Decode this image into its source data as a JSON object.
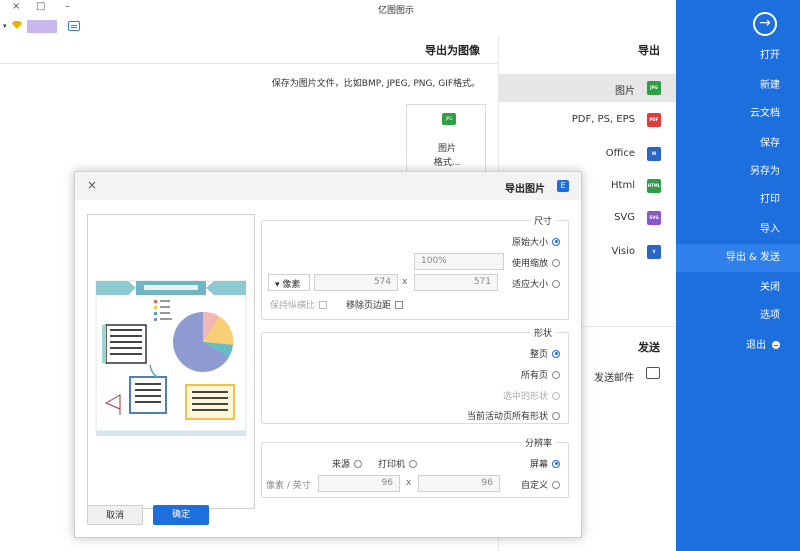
{
  "window": {
    "title": "亿图图示",
    "close": "×",
    "minimize": "–",
    "maximize": "□"
  },
  "toolbar": {
    "dropdown_arrow": "▾",
    "gem_icon": "gem-icon",
    "message_icon": "message-icon"
  },
  "sidebar": {
    "back_glyph": "→",
    "items": [
      {
        "label": "打开"
      },
      {
        "label": "新建"
      },
      {
        "label": "云文档"
      },
      {
        "label": "保存"
      },
      {
        "label": "另存为"
      },
      {
        "label": "打印"
      },
      {
        "label": "导入"
      },
      {
        "label": "导出 & 发送"
      },
      {
        "label": "关闭"
      },
      {
        "label": "选项"
      },
      {
        "label": "退出"
      }
    ],
    "active_index": 7,
    "accent": "#1c6fdc"
  },
  "export_menu": {
    "header": "导出",
    "options": [
      {
        "label": "图片",
        "icon_text": "JPG",
        "color": "#2e9f44"
      },
      {
        "label": "PDF, PS, EPS",
        "icon_text": "PDF",
        "color": "#e23b3b"
      },
      {
        "label": "Office",
        "icon_text": "W",
        "color": "#2b66c7"
      },
      {
        "label": "Html",
        "icon_text": "HTML",
        "color": "#2e9f44"
      },
      {
        "label": "SVG",
        "icon_text": "SVG",
        "color": "#8a56c9"
      },
      {
        "label": "Visio",
        "icon_text": "V",
        "color": "#2b66c7"
      }
    ],
    "selected_index": 0,
    "send_header": "发送",
    "send_label": "发送邮件"
  },
  "content": {
    "title": "导出为图像",
    "description": "保存为图片文件，比如BMP, JPEG, PNG, GIF格式。",
    "card": {
      "icon_text": "JPG",
      "line1": "图片",
      "line2": "格式..."
    }
  },
  "dialog": {
    "title": "导出图片",
    "icon_text": "E",
    "close": "×",
    "size_group": {
      "label": "尺寸",
      "original": "原始大小",
      "zoom": "使用缩放",
      "zoom_value": "100%",
      "fit": "适应大小",
      "width": "571",
      "x": "x",
      "height": "574",
      "unit": "像素",
      "unit_arrow": "▾",
      "remove_margin": "移除页边距",
      "keep_ratio": "保持纵横比"
    },
    "shape_group": {
      "label": "形状",
      "whole_page": "整页",
      "all_pages": "所有页",
      "selected": "选中的形状",
      "current_all": "当前活动页所有形状"
    },
    "resolution_group": {
      "label": "分辨率",
      "screen": "屏幕",
      "print": "打印机",
      "source": "来源",
      "custom": "自定义",
      "dpi1": "96",
      "x": "x",
      "dpi2": "96",
      "unit": "像素 / 英寸"
    },
    "ok": "确定",
    "cancel": "取消"
  }
}
